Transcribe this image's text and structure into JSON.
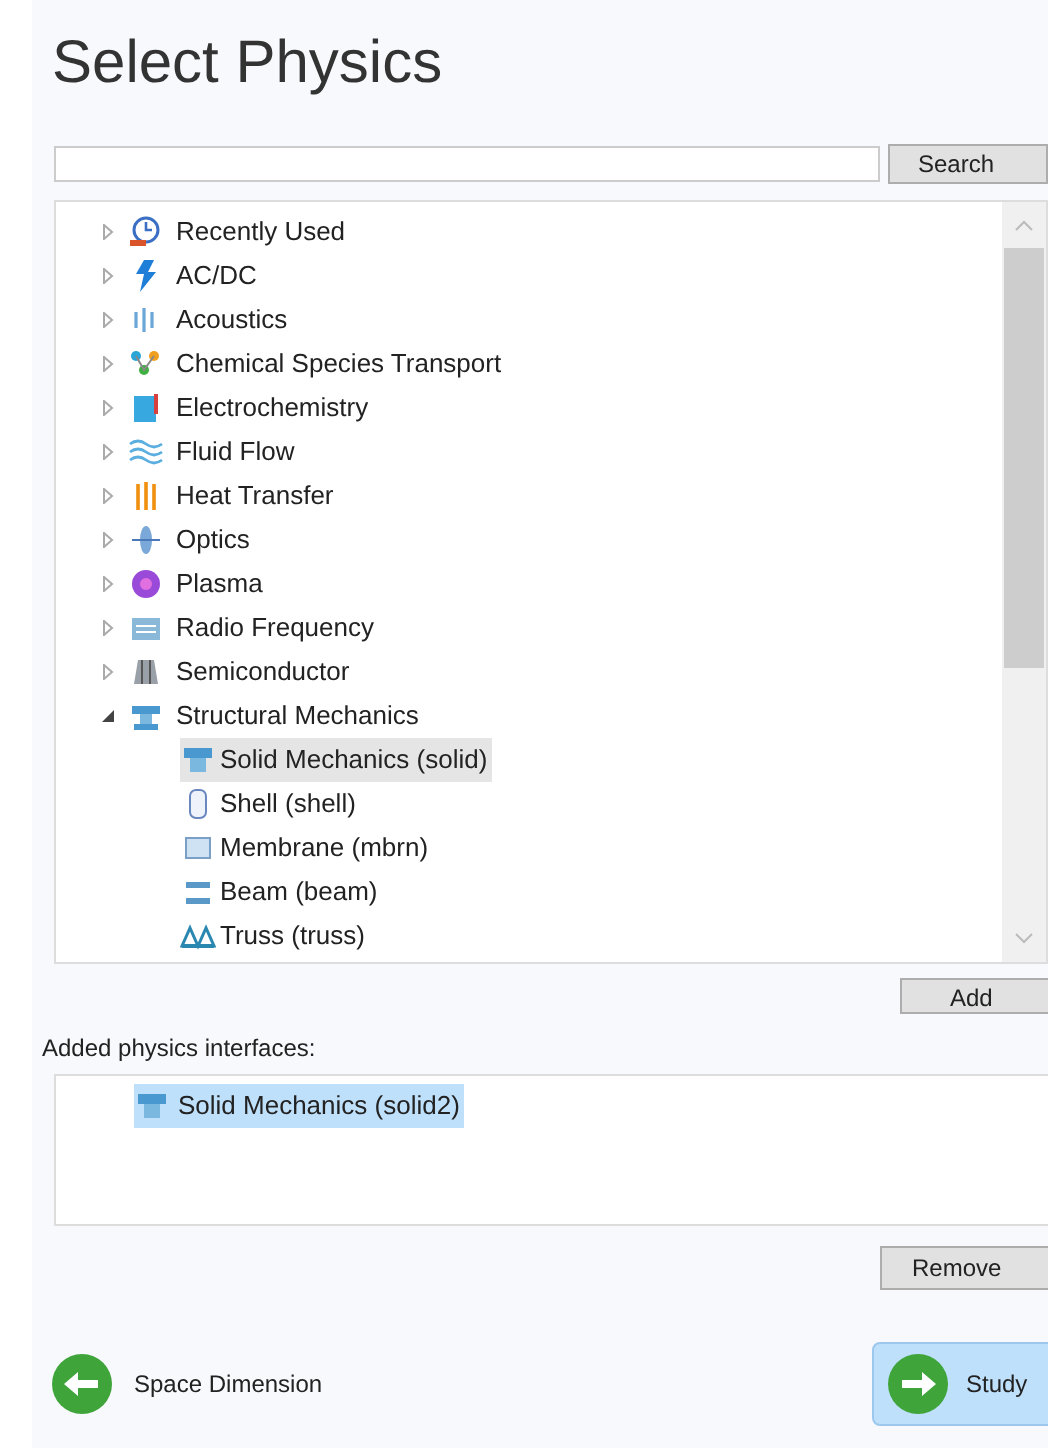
{
  "title": "Select Physics",
  "search": {
    "button": "Search"
  },
  "tree": [
    {
      "label": "Recently Used",
      "expanded": false
    },
    {
      "label": "AC/DC",
      "expanded": false
    },
    {
      "label": "Acoustics",
      "expanded": false
    },
    {
      "label": "Chemical Species Transport",
      "expanded": false
    },
    {
      "label": "Electrochemistry",
      "expanded": false
    },
    {
      "label": "Fluid Flow",
      "expanded": false
    },
    {
      "label": "Heat Transfer",
      "expanded": false
    },
    {
      "label": "Optics",
      "expanded": false
    },
    {
      "label": "Plasma",
      "expanded": false
    },
    {
      "label": "Radio Frequency",
      "expanded": false
    },
    {
      "label": "Semiconductor",
      "expanded": false
    },
    {
      "label": "Structural Mechanics",
      "expanded": true,
      "children": [
        {
          "label": "Solid Mechanics (solid)",
          "selected": true
        },
        {
          "label": "Shell (shell)",
          "selected": false
        },
        {
          "label": "Membrane (mbrn)",
          "selected": false
        },
        {
          "label": "Beam (beam)",
          "selected": false
        },
        {
          "label": "Truss (truss)",
          "selected": false
        }
      ]
    }
  ],
  "add_button": "Add",
  "added_label": "Added physics interfaces:",
  "added": [
    {
      "label": "Solid Mechanics (solid2)",
      "selected": true
    }
  ],
  "remove_button": "Remove",
  "nav": {
    "back": "Space Dimension",
    "next": "Study"
  }
}
